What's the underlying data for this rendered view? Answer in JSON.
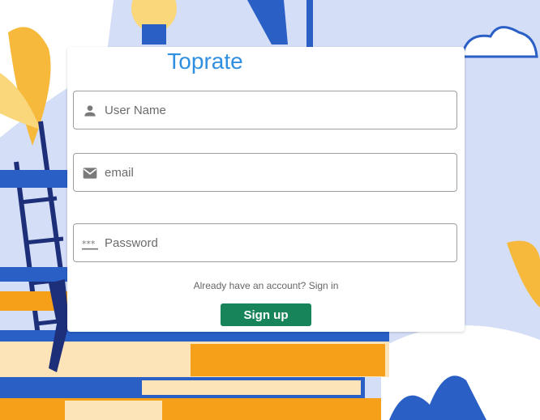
{
  "brand": {
    "name": "Toprate",
    "color": "#2f8fe0"
  },
  "form": {
    "username": {
      "placeholder": "User Name",
      "icon": "person-icon"
    },
    "email": {
      "placeholder": "email",
      "icon": "mail-icon"
    },
    "password": {
      "placeholder": "Password",
      "icon": "password-dots-icon"
    },
    "signin_prompt": "Already have an account?",
    "signin_link": "Sign in",
    "submit_label": "Sign up",
    "submit_color": "#18845a"
  }
}
